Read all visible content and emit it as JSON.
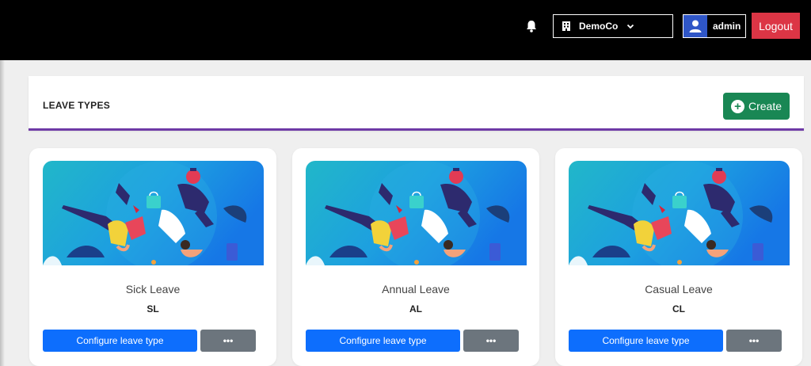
{
  "topbar": {
    "bell_icon": "bell-icon",
    "company": {
      "label": "DemoCo",
      "icon": "building-icon",
      "chevron": "chevron-down-icon"
    },
    "user": {
      "name": "admin",
      "avatar_icon": "user-icon"
    },
    "logout_label": "Logout",
    "colors": {
      "bar": "#000000",
      "logout": "#dc3545",
      "avatar": "#2f56c7"
    }
  },
  "page": {
    "title": "LEAVE TYPES",
    "create_label": "Create",
    "create_icon": "plus-circle-icon",
    "accent_color": "#6f3aa6",
    "create_color": "#198754"
  },
  "leave_types": [
    {
      "name": "Sick Leave",
      "code": "SL",
      "configure_label": "Configure leave type",
      "more_label": "•••"
    },
    {
      "name": "Annual Leave",
      "code": "AL",
      "configure_label": "Configure leave type",
      "more_label": "•••"
    },
    {
      "name": "Casual Leave",
      "code": "CL",
      "configure_label": "Configure leave type",
      "more_label": "•••"
    }
  ]
}
